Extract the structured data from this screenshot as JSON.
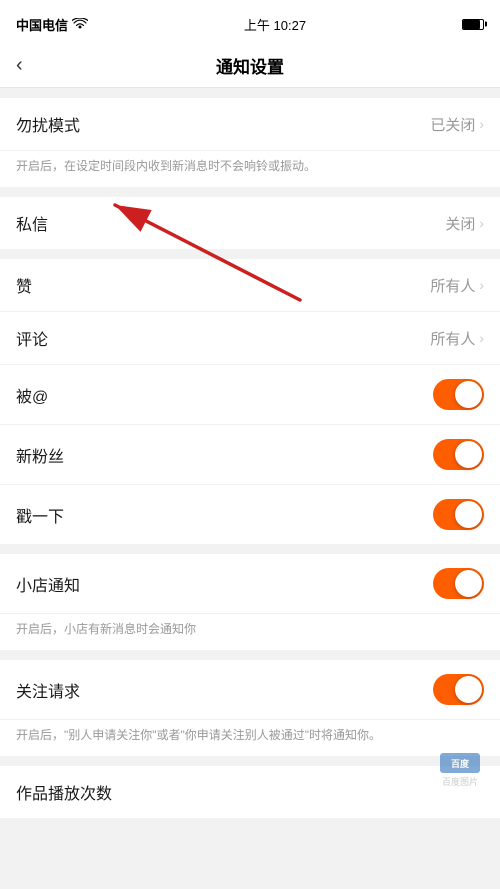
{
  "statusBar": {
    "carrier": "中国电信",
    "wifi": "WiFi",
    "time": "上午 10:27",
    "battery": 85
  },
  "navBar": {
    "backLabel": "‹",
    "title": "通知设置"
  },
  "sections": [
    {
      "id": "dnd",
      "items": [
        {
          "id": "disturb-mode",
          "label": "勿扰模式",
          "valueText": "已关闭",
          "hasChevron": true,
          "hasToggle": false
        }
      ],
      "description": "开启后，在设定时间段内收到新消息时不会响铃或振动。"
    },
    {
      "id": "messages",
      "items": [
        {
          "id": "private-message",
          "label": "私信",
          "valueText": "关闭",
          "hasChevron": true,
          "hasToggle": false
        }
      ]
    },
    {
      "id": "interactions",
      "items": [
        {
          "id": "like",
          "label": "赞",
          "valueText": "所有人",
          "hasChevron": true,
          "hasToggle": false
        },
        {
          "id": "comment",
          "label": "评论",
          "valueText": "所有人",
          "hasChevron": true,
          "hasToggle": false
        },
        {
          "id": "at-mention",
          "label": "被@",
          "valueText": "",
          "hasChevron": false,
          "hasToggle": true,
          "toggleOn": true
        },
        {
          "id": "new-fans",
          "label": "新粉丝",
          "valueText": "",
          "hasChevron": false,
          "hasToggle": true,
          "toggleOn": true
        },
        {
          "id": "shake",
          "label": "戳一下",
          "valueText": "",
          "hasChevron": false,
          "hasToggle": true,
          "toggleOn": true
        }
      ]
    },
    {
      "id": "shop",
      "items": [
        {
          "id": "shop-notice",
          "label": "小店通知",
          "valueText": "",
          "hasChevron": false,
          "hasToggle": true,
          "toggleOn": true
        }
      ],
      "description": "开启后，小店有新消息时会通知你"
    },
    {
      "id": "follow",
      "items": [
        {
          "id": "follow-request",
          "label": "关注请求",
          "valueText": "",
          "hasChevron": false,
          "hasToggle": true,
          "toggleOn": true
        }
      ],
      "description": "开启后，\"别人申请关注你\"或者\"你申请关注别人被通过\"时将通知你。"
    },
    {
      "id": "works",
      "items": [
        {
          "id": "play-count",
          "label": "作品播放次数",
          "valueText": "",
          "hasChevron": false,
          "hasToggle": false
        }
      ]
    }
  ],
  "arrow": {
    "visible": true
  },
  "watermark": {
    "logoText": "百度",
    "subText": "百度图片"
  }
}
